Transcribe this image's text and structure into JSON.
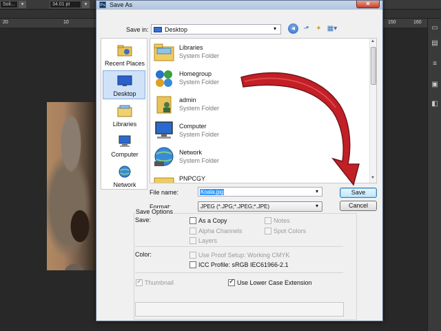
{
  "photoshop": {
    "options_field_1": "Soli...",
    "options_field_2": "34.01 pt",
    "ruler_labels": [
      "20",
      "10",
      "150",
      "160"
    ],
    "ruler_left": "20",
    "ruler_left2": "10",
    "ruler_right1": "150",
    "ruler_right2": "160"
  },
  "dialog": {
    "title": "Save As",
    "ps_badge": "Ps",
    "close_glyph": "✕",
    "save_in_label": "Save in:",
    "save_in_value": "Desktop",
    "places": [
      {
        "label": "Recent Places",
        "icon": "recent-places-icon"
      },
      {
        "label": "Desktop",
        "icon": "desktop-icon"
      },
      {
        "label": "Libraries",
        "icon": "libraries-icon"
      },
      {
        "label": "Computer",
        "icon": "computer-icon"
      },
      {
        "label": "Network",
        "icon": "network-icon"
      }
    ],
    "files": [
      {
        "name": "Libraries",
        "type": "System Folder",
        "icon": "libraries-folder-icon"
      },
      {
        "name": "Homegroup",
        "type": "System Folder",
        "icon": "homegroup-icon"
      },
      {
        "name": "admin",
        "type": "System Folder",
        "icon": "user-folder-icon"
      },
      {
        "name": "Computer",
        "type": "System Folder",
        "icon": "computer-icon"
      },
      {
        "name": "Network",
        "type": "System Folder",
        "icon": "network-icon"
      },
      {
        "name": "PNPCGY",
        "type": "",
        "icon": "folder-icon"
      }
    ],
    "file_name_label": "File name:",
    "file_name_value": "Koala.jpg",
    "format_label": "Format:",
    "format_value": "JPEG (*.JPG;*.JPEG;*.JPE)",
    "save_button": "Save",
    "cancel_button": "Cancel",
    "save_options_title": "Save Options",
    "save_label": "Save:",
    "opt_as_copy": "As a Copy",
    "opt_notes": "Notes",
    "opt_alpha": "Alpha Channels",
    "opt_spot": "Spot Colors",
    "opt_layers": "Layers",
    "color_label": "Color:",
    "opt_proof": "Use Proof Setup:  Working CMYK",
    "opt_icc": "ICC Profile:  sRGB IEC61966-2.1",
    "opt_thumbnail": "Thumbnail",
    "opt_lowercase": "Use Lower Case Extension",
    "checked": {
      "thumbnail": true,
      "lowercase": true
    }
  },
  "colors": {
    "arrow_red": "#c0141b",
    "selection_blue": "#3399ff"
  }
}
